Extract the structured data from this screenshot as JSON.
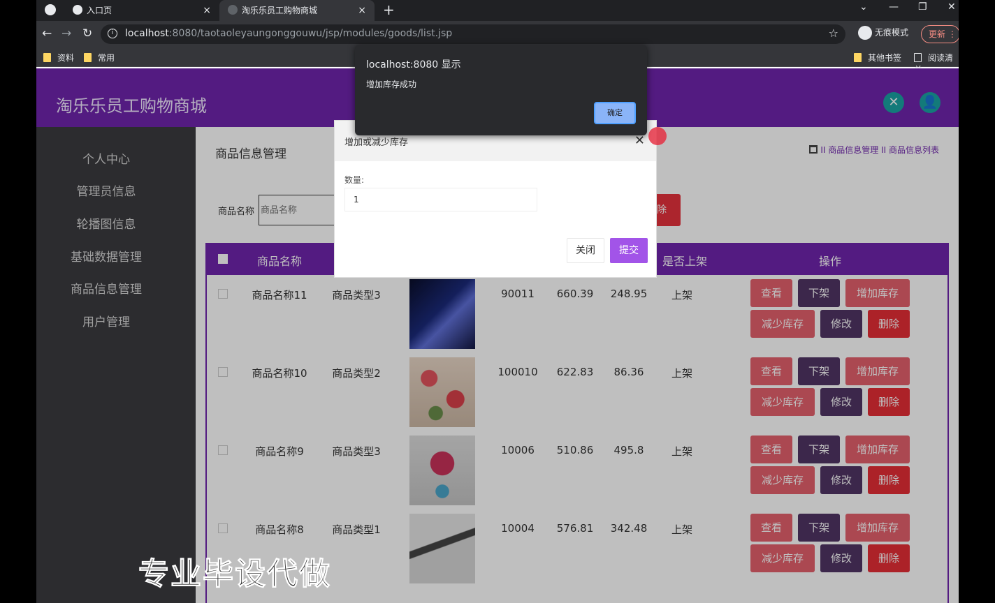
{
  "tabs": [
    {
      "title": "入口页",
      "close": "×"
    },
    {
      "title": "淘乐乐员工购物商城",
      "close": "×"
    }
  ],
  "new_tab": "+",
  "window_controls": [
    "⌄",
    "—",
    "❐",
    "✕"
  ],
  "address": {
    "host": "localhost",
    "rest": ":8080/taotaoleyaungonggouwu/jsp/modules/goods/list.jsp",
    "star": "☆"
  },
  "nav": {
    "back": "←",
    "forward": "→",
    "reload": "↻"
  },
  "incognito_label": "无痕模式",
  "update_label": "更新 ⋮",
  "bookmarks": {
    "left": [
      "资料",
      "常用"
    ],
    "right": [
      "其他书签",
      "阅读清单"
    ]
  },
  "site": {
    "title": "淘乐乐员工购物商城",
    "header_icons": [
      "✕",
      "👤"
    ],
    "sidebar": [
      "个人中心",
      "管理员信息",
      "轮播图信息",
      "基础数据管理",
      "商品信息管理",
      "用户管理"
    ],
    "page_title": "商品信息管理",
    "breadcrumb": "II 商品信息管理 II 商品信息列表",
    "search_label": "商品名称",
    "search_placeholder": "商品名称",
    "delete_top": "除",
    "table": {
      "headers": {
        "name": "商品名称",
        "shelf": "是否上架",
        "ops": "操作"
      },
      "rows": [
        {
          "name": "商品名称11",
          "type": "商品类型3",
          "code": "90011",
          "price": "660.39",
          "vip": "248.95",
          "shelf": "上架"
        },
        {
          "name": "商品名称10",
          "type": "商品类型2",
          "code": "100010",
          "price": "622.83",
          "vip": "86.36",
          "shelf": "上架"
        },
        {
          "name": "商品名称9",
          "type": "商品类型3",
          "code": "10006",
          "price": "510.86",
          "vip": "495.8",
          "shelf": "上架"
        },
        {
          "name": "商品名称8",
          "type": "商品类型1",
          "code": "10004",
          "price": "576.81",
          "vip": "342.48",
          "shelf": "上架"
        }
      ],
      "buttons": {
        "view": "查看",
        "off": "下架",
        "add": "增加库存",
        "sub": "减少库存",
        "edit": "修改",
        "del": "删除"
      }
    }
  },
  "modal": {
    "title": "增加或减少库存",
    "close_x": "✕",
    "label": "数量:",
    "value": "1",
    "close": "关闭",
    "submit": "提交"
  },
  "alert": {
    "title": "localhost:8080 显示",
    "message": "增加库存成功",
    "ok": "确定"
  },
  "watermark": "专业毕设代做"
}
